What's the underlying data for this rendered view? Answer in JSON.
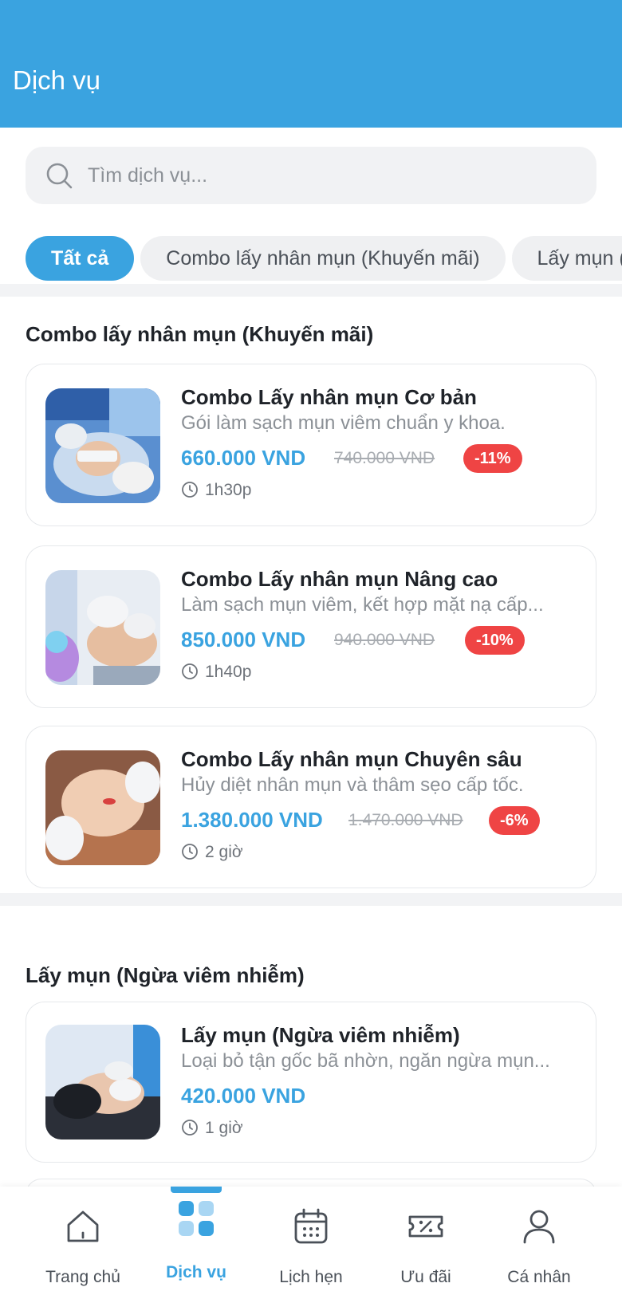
{
  "header": {
    "title": "Dịch vụ"
  },
  "search": {
    "placeholder": "Tìm dịch vụ...",
    "value": ""
  },
  "chips": [
    {
      "label": "Tất cả",
      "active": true
    },
    {
      "label": "Combo lấy nhân mụn (Khuyến mãi)",
      "active": false
    },
    {
      "label": "Lấy mụn (Ngừa viêm nhiễm)",
      "active": false
    }
  ],
  "sections": [
    {
      "title": "Combo lấy nhân mụn (Khuyến mãi)",
      "services": [
        {
          "name": "Combo Lấy nhân mụn Cơ bản",
          "description": "Gói làm sạch mụn viêm chuẩn y khoa.",
          "price": "660.000 VND",
          "old_price": "740.000 VND",
          "discount": "-11%",
          "duration": "1h30p"
        },
        {
          "name": "Combo Lấy nhân mụn Nâng cao",
          "description": "Làm sạch mụn viêm, kết hợp mặt nạ cấp...",
          "price": "850.000 VND",
          "old_price": "940.000 VND",
          "discount": "-10%",
          "duration": "1h40p"
        },
        {
          "name": "Combo Lấy nhân mụn Chuyên sâu",
          "description": "Hủy diệt nhân mụn và thâm sẹo cấp tốc.",
          "price": "1.380.000 VND",
          "old_price": "1.470.000 VND",
          "discount": "-6%",
          "duration": "2 giờ"
        }
      ]
    },
    {
      "title": "Lấy mụn (Ngừa viêm nhiễm)",
      "services": [
        {
          "name": "Lấy mụn (Ngừa viêm nhiễm)",
          "description": "Loại bỏ tận gốc bã nhờn, ngăn ngừa mụn...",
          "price": "420.000 VND",
          "duration": "1 giờ"
        }
      ]
    }
  ],
  "nav": [
    {
      "label": "Trang chủ",
      "icon": "home-icon",
      "active": false
    },
    {
      "label": "Dịch vụ",
      "icon": "services-grid-icon",
      "active": true
    },
    {
      "label": "Lịch hẹn",
      "icon": "calendar-icon",
      "active": false
    },
    {
      "label": "Ưu đãi",
      "icon": "ticket-discount-icon",
      "active": false
    },
    {
      "label": "Cá nhân",
      "icon": "user-icon",
      "active": false
    }
  ],
  "colors": {
    "primary": "#3aa3e0",
    "discount_badge": "#ef4444",
    "price": "#3aa3e0"
  }
}
